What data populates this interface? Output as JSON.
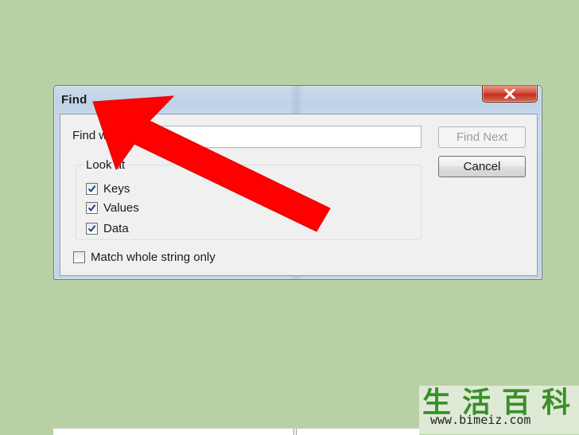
{
  "dialog": {
    "title": "Find",
    "find_what_label": "Find what:",
    "find_what_value": "",
    "find_next_label": "Find Next",
    "cancel_label": "Cancel",
    "look_at_label": "Look at",
    "checkboxes": [
      {
        "label": "Keys",
        "checked": true
      },
      {
        "label": "Values",
        "checked": true
      },
      {
        "label": "Data",
        "checked": true
      }
    ],
    "match_whole_string": {
      "label": "Match whole string only",
      "checked": false
    }
  },
  "annotation": {
    "arrow_color": "#ff0000"
  },
  "watermark": {
    "chars": "生活百科",
    "url": "www.bimeiz.com"
  },
  "colors": {
    "background": "#b8d1a4",
    "close_button": "#c0301f",
    "watermark_green": "#3a8f2a"
  },
  "icons": {
    "close": "close-x-icon",
    "check": "checkmark-icon"
  }
}
